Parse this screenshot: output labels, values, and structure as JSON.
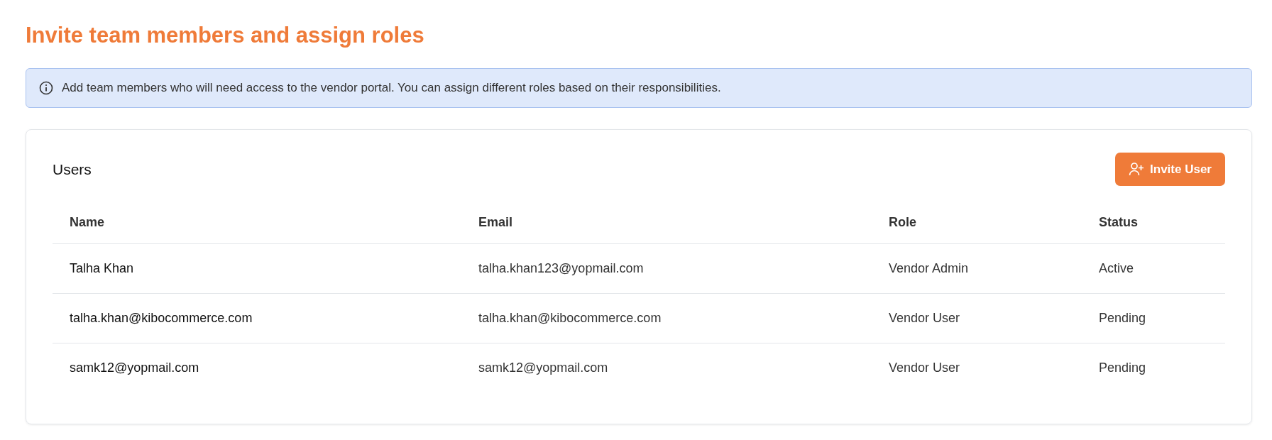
{
  "title": "Invite team members and assign roles",
  "notice": "Add team members who will need access to the vendor portal. You can assign different roles based on their responsibilities.",
  "users_card": {
    "heading": "Users",
    "invite_button": "Invite User",
    "table": {
      "columns": [
        "Name",
        "Email",
        "Role",
        "Status"
      ],
      "rows": [
        [
          "Talha Khan",
          "talha.khan123@yopmail.com",
          "Vendor Admin",
          "Active"
        ],
        [
          "talha.khan@kibocommerce.com",
          "talha.khan@kibocommerce.com",
          "Vendor User",
          "Pending"
        ],
        [
          "samk12@yopmail.com",
          "samk12@yopmail.com",
          "Vendor User",
          "Pending"
        ]
      ]
    }
  }
}
